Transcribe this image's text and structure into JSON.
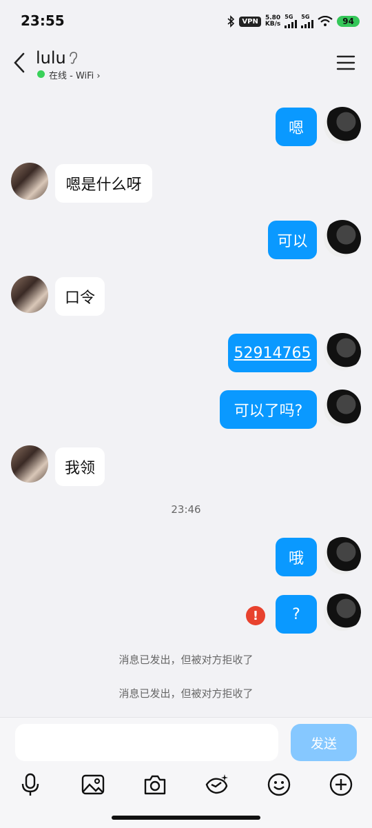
{
  "status_bar": {
    "time": "23:55",
    "vpn": "VPN",
    "speed_value": "5.80",
    "speed_unit": "KB/s",
    "net1": "5G",
    "net2": "5G",
    "battery": "94"
  },
  "header": {
    "name": "lulu",
    "status": "在线 - WiFi ›"
  },
  "messages": [
    {
      "side": "mine",
      "text": "嗯"
    },
    {
      "side": "theirs",
      "text": "嗯是什么呀"
    },
    {
      "side": "mine",
      "text": "可以"
    },
    {
      "side": "theirs",
      "text": "口令"
    },
    {
      "side": "mine",
      "text": "52914765"
    },
    {
      "side": "mine",
      "text": "可以了吗?"
    },
    {
      "side": "theirs",
      "text": "我领"
    },
    {
      "side": "mine",
      "text": "哦"
    },
    {
      "side": "mine",
      "text": "?",
      "error": true
    }
  ],
  "time_divider": "23:46",
  "error_mark": "!",
  "system_notes": [
    "消息已发出，但被对方拒收了",
    "消息已发出，但被对方拒收了"
  ],
  "input": {
    "value": "",
    "send_label": "发送"
  },
  "toolbar": [
    "mic-icon",
    "image-icon",
    "camera-icon",
    "red-packet-icon",
    "emoji-icon",
    "plus-icon"
  ],
  "colors": {
    "bubble_mine": "#0a99ff",
    "bubble_theirs": "#ffffff",
    "send_disabled": "#86c8ff",
    "online": "#3ad15a",
    "error": "#e8422e"
  }
}
